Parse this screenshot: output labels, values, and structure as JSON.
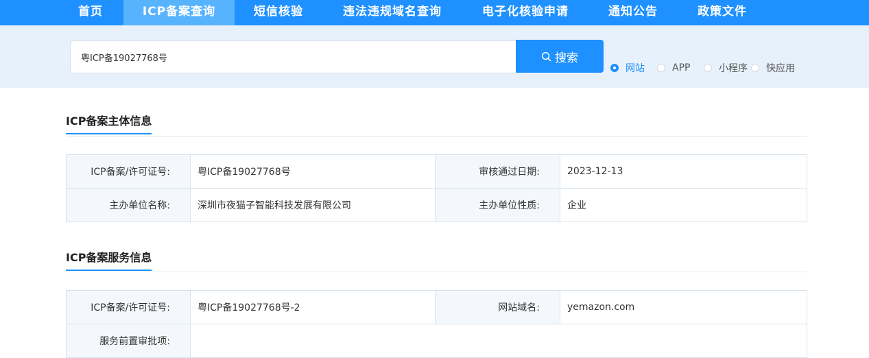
{
  "nav": {
    "items": [
      {
        "label": "首页"
      },
      {
        "label": "ICP备案查询"
      },
      {
        "label": "短信核验"
      },
      {
        "label": "违法违规域名查询"
      },
      {
        "label": "电子化核验申请"
      },
      {
        "label": "通知公告"
      },
      {
        "label": "政策文件"
      }
    ],
    "active_index": 1
  },
  "search": {
    "value": "粤ICP备19027768号",
    "button_label": "搜索",
    "types": [
      {
        "label": "网站",
        "checked": true
      },
      {
        "label": "APP",
        "checked": false
      },
      {
        "label": "小程序",
        "checked": false
      },
      {
        "label": "快应用",
        "checked": false
      }
    ]
  },
  "subject": {
    "title": "ICP备案主体信息",
    "rows": [
      {
        "label1": "ICP备案/许可证号:",
        "value1": "粤ICP备19027768号",
        "label2": "审核通过日期:",
        "value2": "2023-12-13"
      },
      {
        "label1": "主办单位名称:",
        "value1": "深圳市夜猫子智能科技发展有限公司",
        "label2": "主办单位性质:",
        "value2": "企业"
      }
    ]
  },
  "service": {
    "title": "ICP备案服务信息",
    "rows": [
      {
        "label1": "ICP备案/许可证号:",
        "value1": "粤ICP备19027768号-2",
        "label2": "网站域名:",
        "value2": "yemazon.com"
      },
      {
        "label1": "服务前置审批项:",
        "value1": ""
      }
    ]
  },
  "colors": {
    "nav_bg": "#1e90ff",
    "nav_active": "#58b3ff",
    "search_band": "#e6f1fc",
    "accent": "#1e90ff"
  }
}
